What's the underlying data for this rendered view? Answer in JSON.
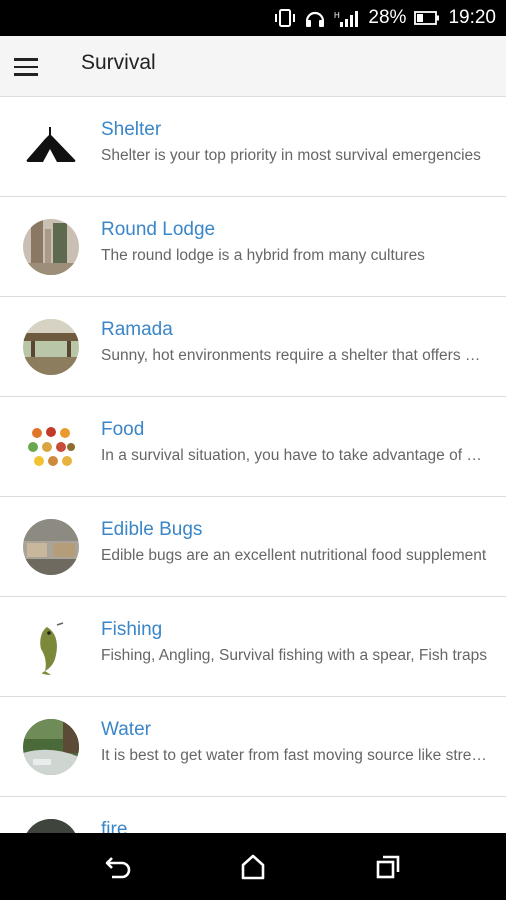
{
  "status_bar": {
    "battery": "28%",
    "time": "19:20",
    "icons": [
      "vibrate-icon",
      "headset-icon",
      "signal-icon",
      "battery-icon"
    ]
  },
  "app_bar": {
    "title": "Survival",
    "menu_icon": "hamburger-menu-icon"
  },
  "colors": {
    "title_link": "#3a86c8",
    "description": "#666666",
    "app_bar_bg": "#f5f5f5"
  },
  "items": [
    {
      "title": "Shelter",
      "description": "Shelter is your top priority in most survival emergencies",
      "icon": "tent-icon"
    },
    {
      "title": "Round Lodge",
      "description": "The round lodge is a hybrid from many cultures",
      "icon": "round-lodge-thumbnail"
    },
    {
      "title": "Ramada",
      "description": "Sunny, hot environments require a shelter that offers shade",
      "icon": "ramada-thumbnail"
    },
    {
      "title": "Food",
      "description": "In a survival situation, you have to take advantage of every food source",
      "icon": "food-thumbnail"
    },
    {
      "title": "Edible Bugs",
      "description": "Edible bugs are an excellent nutritional food supplement",
      "icon": "edible-bugs-thumbnail"
    },
    {
      "title": "Fishing",
      "description": "Fishing, Angling, Survival fishing with a spear, Fish traps",
      "icon": "fish-thumbnail"
    },
    {
      "title": "Water",
      "description": "It is best to get water from fast moving source like streams",
      "icon": "water-thumbnail"
    },
    {
      "title": "fire",
      "description": "",
      "icon": "fire-thumbnail"
    }
  ],
  "nav_bar": {
    "icons": [
      "back-icon",
      "home-icon",
      "recents-icon"
    ]
  }
}
